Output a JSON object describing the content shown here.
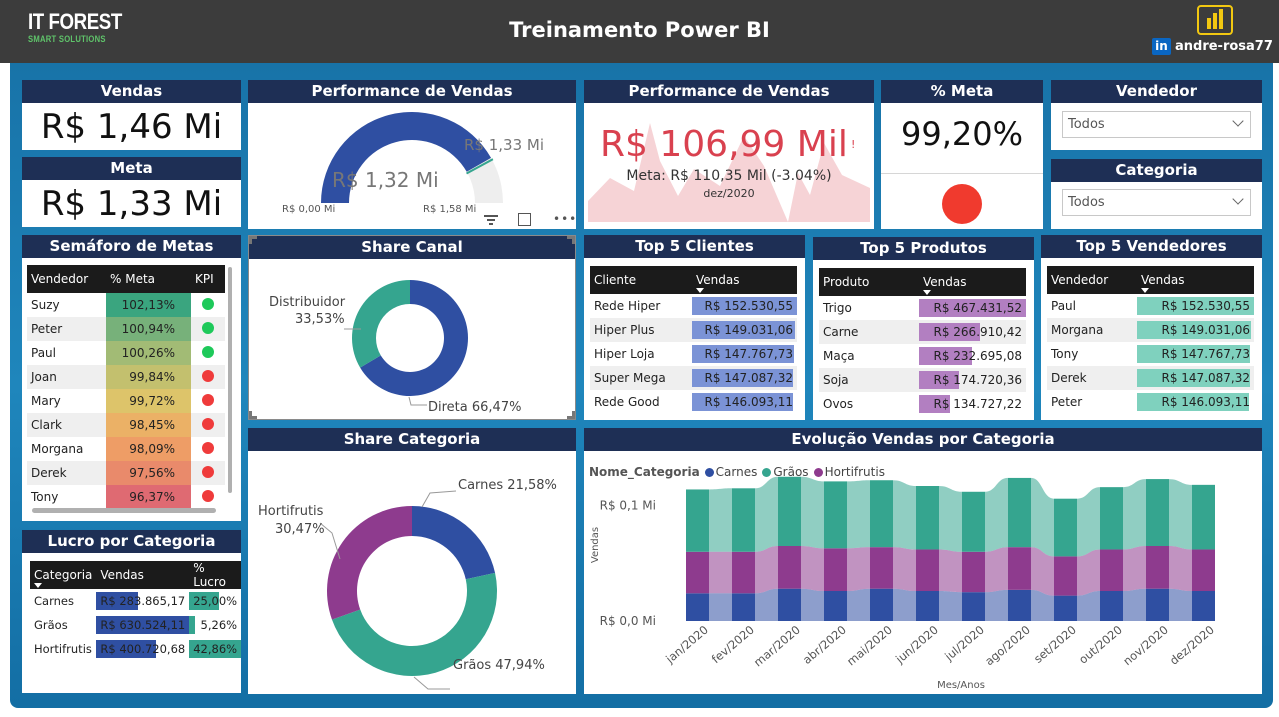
{
  "header": {
    "logo_line1": "IT FOREST",
    "logo_line2": "SMART SOLUTIONS",
    "title": "Treinamento Power BI",
    "linkedin_badge": "in",
    "linkedin_user": "andre-rosa77",
    "powerbi_icon": "power-bi-icon"
  },
  "vendas": {
    "title": "Vendas",
    "value": "R$ 1,46 Mi"
  },
  "meta": {
    "title": "Meta",
    "value": "R$ 1,33 Mi"
  },
  "gauge": {
    "title": "Performance de Vendas",
    "value_label": "R$ 1,32 Mi",
    "target_label": "R$ 1,33 Mi",
    "min_label": "R$ 0,00 Mi",
    "max_label": "R$ 1,58 Mi",
    "fill_fraction": 0.835,
    "target_fraction": 0.842,
    "toolbar_icons": [
      "filter-icon",
      "focus-mode-icon",
      "more-options-icon"
    ]
  },
  "perf_card": {
    "title": "Performance de Vendas",
    "value": "R$ 106,99 Mil",
    "alert": "!",
    "meta": "Meta: R$ 110,35 Mil (-3.04%)",
    "period": "dez/2020"
  },
  "pct_meta": {
    "title": "% Meta",
    "value": "99,20%",
    "status_color": "#f03a2e"
  },
  "vendedor_slicer": {
    "title": "Vendedor",
    "value": "Todos"
  },
  "categoria_slicer": {
    "title": "Categoria",
    "value": "Todos"
  },
  "semaforo": {
    "title": "Semáforo de Metas",
    "columns": [
      "Vendedor",
      "% Meta",
      "KPI"
    ],
    "rows": [
      {
        "name": "Suzy",
        "pct": "102,13%",
        "bg": "#3aa57f",
        "kpi": "#1ec95a"
      },
      {
        "name": "Peter",
        "pct": "100,94%",
        "bg": "#77b17a",
        "kpi": "#1ec95a"
      },
      {
        "name": "Paul",
        "pct": "100,26%",
        "bg": "#a2bb75",
        "kpi": "#1ec95a"
      },
      {
        "name": "Joan",
        "pct": "99,84%",
        "bg": "#c3c06e",
        "kpi": "#ef3b3b"
      },
      {
        "name": "Mary",
        "pct": "99,72%",
        "bg": "#ddc46a",
        "kpi": "#ef3b3b"
      },
      {
        "name": "Clark",
        "pct": "98,45%",
        "bg": "#ebb166",
        "kpi": "#ef3b3b"
      },
      {
        "name": "Morgana",
        "pct": "98,09%",
        "bg": "#ee9d66",
        "kpi": "#ef3b3b"
      },
      {
        "name": "Derek",
        "pct": "97,56%",
        "bg": "#e98a6b",
        "kpi": "#ef3b3b"
      },
      {
        "name": "Tony",
        "pct": "96,37%",
        "bg": "#df6a72",
        "kpi": "#ef3b3b"
      }
    ]
  },
  "lucro": {
    "title": "Lucro por Categoria",
    "columns": [
      "Categoria",
      "Vendas",
      "% Lucro"
    ],
    "rows": [
      {
        "cat": "Carnes",
        "vendas": "R$ 283.865,17",
        "vendas_frac": 0.45,
        "lucro": "25,00%",
        "lucro_frac": 0.58
      },
      {
        "cat": "Grãos",
        "vendas": "R$ 630.524,11",
        "vendas_frac": 1.0,
        "lucro": "5,26%",
        "lucro_frac": 0.12
      },
      {
        "cat": "Hortifrutis",
        "vendas": "R$ 400.720,68",
        "vendas_frac": 0.64,
        "lucro": "42,86%",
        "lucro_frac": 1.0
      }
    ]
  },
  "share_canal": {
    "title": "Share Canal",
    "slices": [
      {
        "name": "Direta",
        "label": "Direta 66,47%",
        "value": 66.47,
        "color": "#2f4fa2"
      },
      {
        "name": "Distribuidor",
        "label": "Distribuidor",
        "pct": "33,53%",
        "value": 33.53,
        "color": "#35a58f"
      }
    ]
  },
  "share_categoria": {
    "title": "Share Categoria",
    "slices": [
      {
        "name": "Carnes",
        "label": "Carnes 21,58%",
        "value": 21.58,
        "color": "#2f4fa2"
      },
      {
        "name": "Grãos",
        "label": "Grãos 47,94%",
        "value": 47.94,
        "color": "#35a58f"
      },
      {
        "name": "Hortifrutis",
        "label": "Hortifrutis",
        "pct": "30,47%",
        "value": 30.47,
        "color": "#8e3b8e"
      }
    ]
  },
  "top_clientes": {
    "title": "Top 5 Clientes",
    "columns": [
      "Cliente",
      "Vendas"
    ],
    "bar_color": "#7b93d6",
    "rows": [
      {
        "name": "Rede Hiper",
        "value": "R$ 152.530,55",
        "frac": 1.0
      },
      {
        "name": "Hiper Plus",
        "value": "R$ 149.031,06",
        "frac": 0.977
      },
      {
        "name": "Hiper Loja",
        "value": "R$ 147.767,73",
        "frac": 0.969
      },
      {
        "name": "Super Mega",
        "value": "R$ 147.087,32",
        "frac": 0.964
      },
      {
        "name": "Rede Good",
        "value": "R$ 146.093,11",
        "frac": 0.958
      }
    ]
  },
  "top_produtos": {
    "title": "Top 5 Produtos",
    "columns": [
      "Produto",
      "Vendas"
    ],
    "bar_color": "#b27fc1",
    "rows": [
      {
        "name": "Trigo",
        "value": "R$ 467.431,52",
        "frac": 1.0
      },
      {
        "name": "Carne",
        "value": "R$ 266.910,42",
        "frac": 0.571
      },
      {
        "name": "Maça",
        "value": "R$ 232.695,08",
        "frac": 0.498
      },
      {
        "name": "Soja",
        "value": "R$ 174.720,36",
        "frac": 0.374
      },
      {
        "name": "Ovos",
        "value": "R$ 134.727,22",
        "frac": 0.288
      }
    ]
  },
  "top_vendedores": {
    "title": "Top 5 Vendedores",
    "columns": [
      "Vendedor",
      "Vendas"
    ],
    "bar_color": "#7fd1be",
    "rows": [
      {
        "name": "Paul",
        "value": "R$ 152.530,55",
        "frac": 1.0
      },
      {
        "name": "Morgana",
        "value": "R$ 149.031,06",
        "frac": 0.977
      },
      {
        "name": "Tony",
        "value": "R$ 147.767,73",
        "frac": 0.969
      },
      {
        "name": "Derek",
        "value": "R$ 147.087,32",
        "frac": 0.964
      },
      {
        "name": "Peter",
        "value": "R$ 146.093,11",
        "frac": 0.958
      }
    ]
  },
  "chart_data": {
    "type": "area",
    "title": "Evolução Vendas por Categoria",
    "legend_title": "Nome_Categoria",
    "legend_position": "top-left",
    "xlabel": "Mes/Anos",
    "ylabel": "Vendas",
    "y_tick_labels": [
      "R$ 0,0 Mi",
      "R$ 0,1 Mi"
    ],
    "y_ticks": [
      0,
      0.1
    ],
    "ylim": [
      0,
      0.13
    ],
    "grid": false,
    "x": [
      "jan/2020",
      "fev/2020",
      "mar/2020",
      "abr/2020",
      "mai/2020",
      "jun/2020",
      "jul/2020",
      "ago/2020",
      "set/2020",
      "out/2020",
      "nov/2020",
      "dez/2020"
    ],
    "series": [
      {
        "name": "Carnes",
        "color": "#2f4fa2",
        "values": [
          0.024,
          0.024,
          0.028,
          0.026,
          0.028,
          0.026,
          0.025,
          0.027,
          0.022,
          0.026,
          0.028,
          0.026
        ]
      },
      {
        "name": "Grãos",
        "color": "#35a58f",
        "values": [
          0.054,
          0.055,
          0.06,
          0.058,
          0.058,
          0.055,
          0.052,
          0.06,
          0.05,
          0.054,
          0.058,
          0.056
        ]
      },
      {
        "name": "Hortifrutis",
        "color": "#8e3b8e",
        "values": [
          0.036,
          0.036,
          0.037,
          0.037,
          0.036,
          0.036,
          0.035,
          0.037,
          0.034,
          0.036,
          0.037,
          0.036
        ]
      }
    ]
  }
}
